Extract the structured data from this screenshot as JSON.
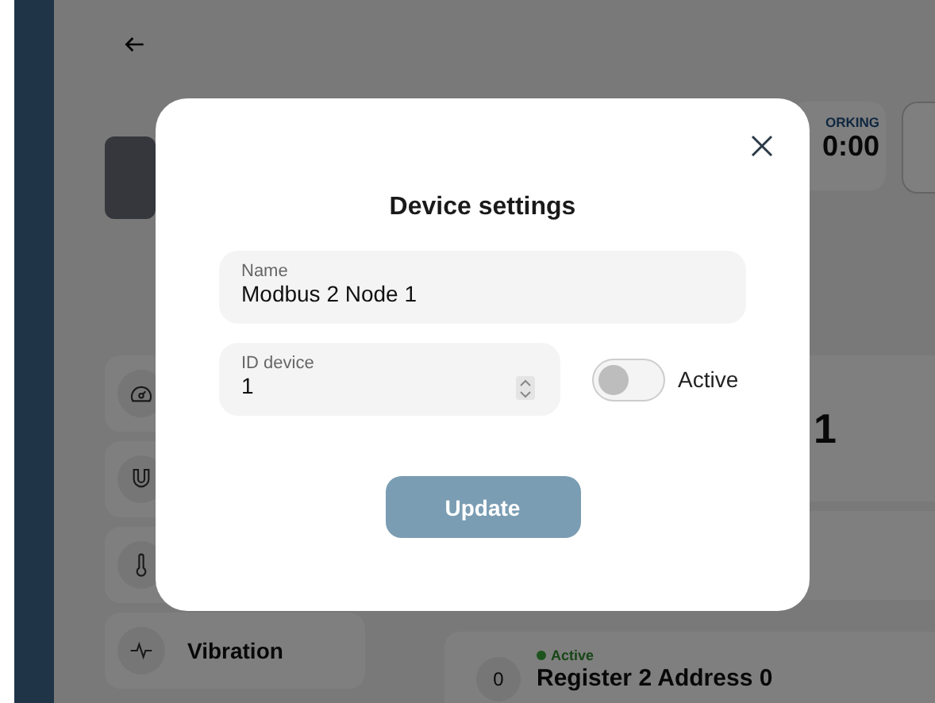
{
  "background": {
    "status_label": "ORKING",
    "status_time": "0:00",
    "sensor_tabs": [
      {
        "kind": "gauge"
      },
      {
        "kind": "magnet"
      },
      {
        "kind": "thermometer"
      },
      {
        "kind": "vibration",
        "label": "Vibration"
      }
    ],
    "reading_value": "1",
    "register": {
      "index": "0",
      "status": "Active",
      "name": "Register 2 Address 0"
    }
  },
  "modal": {
    "title": "Device settings",
    "fields": [
      {
        "label": "Name",
        "value": "Modbus 2 Node 1",
        "kind": "text"
      },
      {
        "label": "ID device",
        "value": "1",
        "kind": "number"
      }
    ],
    "active_toggle": {
      "label": "Active",
      "on": false
    },
    "button": {
      "label": "Update",
      "disabled": true
    }
  }
}
